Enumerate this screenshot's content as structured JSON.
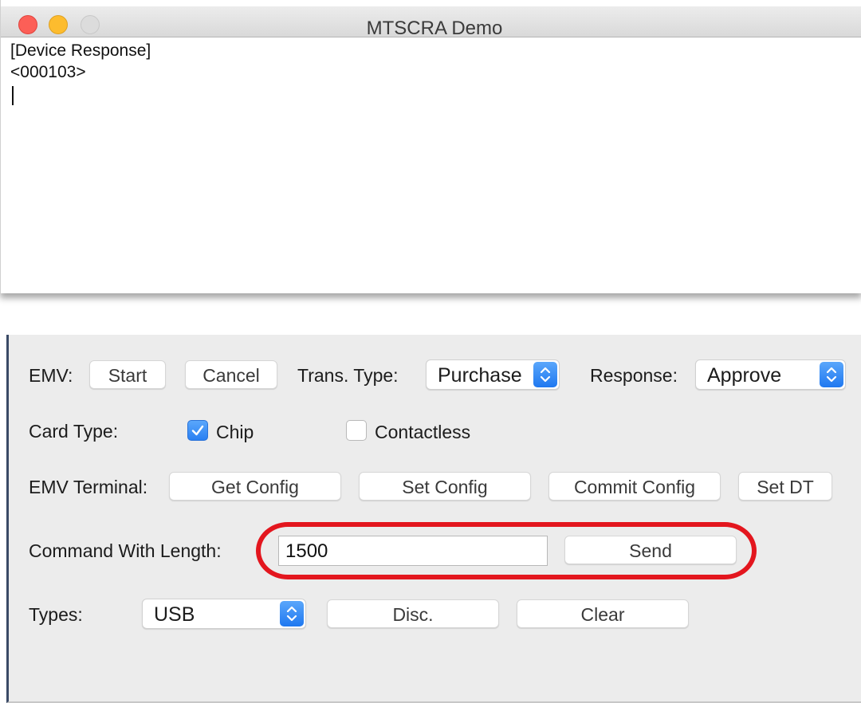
{
  "window": {
    "title": "MTSCRA Demo",
    "output_lines": [
      "[Device Response]",
      "<000103>"
    ]
  },
  "panel": {
    "emv": {
      "label": "EMV:",
      "start_label": "Start",
      "cancel_label": "Cancel",
      "trans_type_label": "Trans. Type:",
      "trans_type_value": "Purchase",
      "response_label": "Response:",
      "response_value": "Approve"
    },
    "card_type": {
      "label": "Card Type:",
      "chip_label": "Chip",
      "chip_checked": true,
      "contactless_label": "Contactless",
      "contactless_checked": false
    },
    "emv_terminal": {
      "label": "EMV Terminal:",
      "get_config_label": "Get Config",
      "set_config_label": "Set Config",
      "commit_config_label": "Commit Config",
      "set_dt_label": "Set DT"
    },
    "command": {
      "label": "Command With Length:",
      "input_value": "1500",
      "send_label": "Send"
    },
    "types": {
      "label": "Types:",
      "value": "USB",
      "disc_label": "Disc.",
      "clear_label": "Clear"
    }
  },
  "colors": {
    "accent": "#1f78f0",
    "highlight": "#e3161e",
    "panel_bg": "#ececec"
  }
}
